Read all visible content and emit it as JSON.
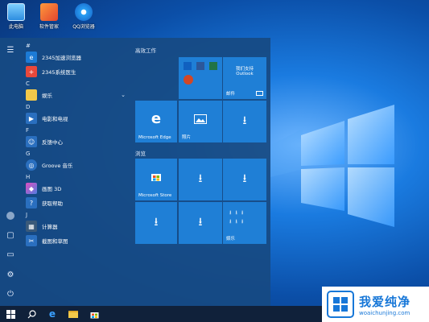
{
  "desktop": {
    "icons": [
      {
        "label": "此电脑",
        "icon": "computer-icon"
      },
      {
        "label": "软件管家",
        "icon": "software-manager-icon"
      },
      {
        "label": "QQ浏览器",
        "icon": "qq-browser-icon"
      }
    ]
  },
  "start_menu": {
    "rail": [
      "hamburger-icon",
      "user-avatar-icon",
      "documents-icon",
      "pictures-icon",
      "settings-icon",
      "power-icon"
    ],
    "apps": [
      {
        "letter": "#"
      },
      {
        "name": "2345加速浏览器",
        "icon": "browser-2345-icon",
        "color": "#1c7bd6"
      },
      {
        "name": "2345系统医生",
        "icon": "system-doctor-icon",
        "color": "#e9483b"
      },
      {
        "letter": "C"
      },
      {
        "name": "娱乐",
        "icon": "folder-icon",
        "color": "#f3c94a",
        "expandable": true
      },
      {
        "letter": "D"
      },
      {
        "name": "电影和电视",
        "icon": "movies-tv-icon",
        "color": "#2a6fbf"
      },
      {
        "letter": "F"
      },
      {
        "name": "反馈中心",
        "icon": "feedback-icon",
        "color": "#2a6fbf"
      },
      {
        "letter": "G"
      },
      {
        "name": "Groove 音乐",
        "icon": "groove-music-icon",
        "color": "#2a6fbf"
      },
      {
        "letter": "H"
      },
      {
        "name": "画图 3D",
        "icon": "paint3d-icon",
        "color": "#a04fd0"
      },
      {
        "name": "获取帮助",
        "icon": "get-help-icon",
        "color": "#2a6fbf"
      },
      {
        "letter": "J"
      },
      {
        "name": "计算器",
        "icon": "calculator-icon",
        "color": "#3a5a7a"
      },
      {
        "name": "截图和草图",
        "icon": "snip-sketch-icon",
        "color": "#2a6fbf"
      }
    ],
    "groups": {
      "productivity": "高效工作",
      "browse": "浏览"
    },
    "tiles": {
      "outlook_line1": "我们支持",
      "outlook_line2": "Outlook",
      "mail": "邮件",
      "edge": "Microsoft Edge",
      "photos": "照片",
      "store": "Microsoft Store",
      "entertainment": "娱乐"
    }
  },
  "taskbar": {
    "items": [
      "windows-start-icon",
      "search-icon",
      "edge-icon",
      "file-explorer-icon",
      "store-icon"
    ]
  },
  "watermark": {
    "cn": "我爱纯净",
    "url": "woaichunjing.com"
  }
}
